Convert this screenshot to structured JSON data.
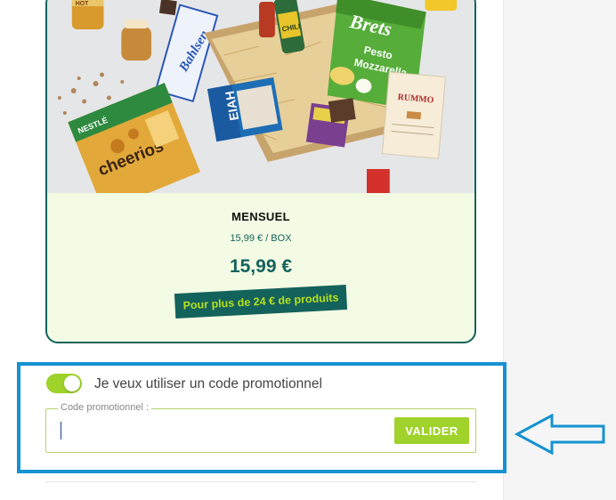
{
  "plan": {
    "name": "MENSUEL",
    "unit_price": "15,99 € / BOX",
    "price": "15,99 €",
    "ribbon": "Pour plus de 24 € de produits"
  },
  "product_image": {
    "brand_chips": "Brets",
    "chips_flavor_line1": "Pesto",
    "chips_flavor_line2": "Mozzarella",
    "chocolate_brand": "EIAH",
    "pasta_brand": "RUMMO",
    "cereal_name": "cheerios",
    "cereal_brand": "NESTLÉ",
    "chili_sauce": "CHILI",
    "biscuit_brand": "Bahlsen",
    "hot_label": "HOT"
  },
  "promo": {
    "toggle_label": "Je veux utiliser un code promotionnel",
    "toggle_on": true,
    "field_label": "Code promotionnel :",
    "field_value": "",
    "validate_label": "VALIDER"
  },
  "colors": {
    "brand_teal": "#14625c",
    "accent_green": "#9fd22a",
    "ribbon_text": "#b7e21c",
    "card_bg": "#f3fbe4",
    "highlight_blue": "#1592d0"
  }
}
